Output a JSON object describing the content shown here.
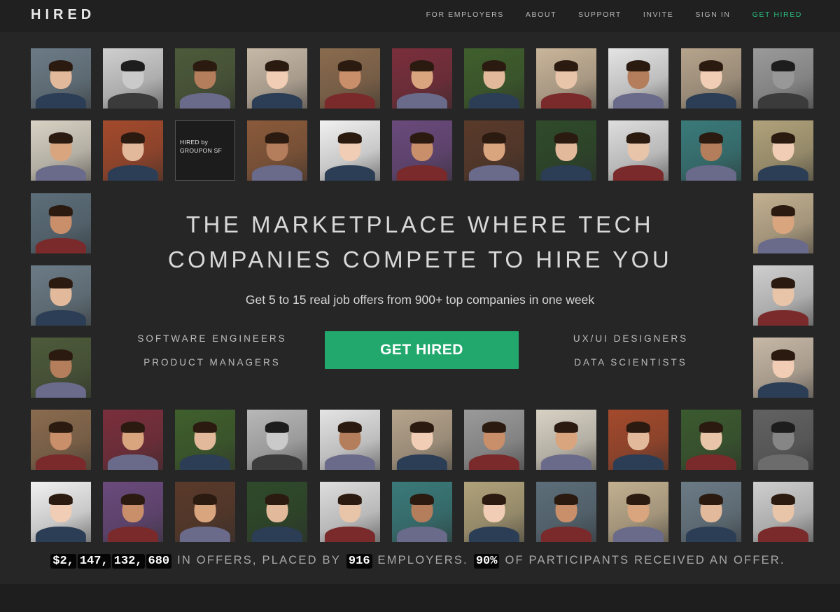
{
  "brand": {
    "logo": "HIRED"
  },
  "nav": {
    "items": [
      {
        "label": "FOR EMPLOYERS",
        "accent": false
      },
      {
        "label": "ABOUT",
        "accent": false
      },
      {
        "label": "SUPPORT",
        "accent": false
      },
      {
        "label": "INVITE",
        "accent": false
      },
      {
        "label": "SIGN IN",
        "accent": false
      },
      {
        "label": "GET HIRED",
        "accent": true
      }
    ]
  },
  "hero": {
    "title_line1": "THE MARKETPLACE WHERE TECH",
    "title_line2": "COMPANIES COMPETE TO HIRE YOU",
    "subtitle": "Get 5 to 15 real job offers from 900+ top companies in one week",
    "roles_left": [
      "SOFTWARE ENGINEERS",
      "PRODUCT MANAGERS"
    ],
    "roles_right": [
      "UX/UI DESIGNERS",
      "DATA SCIENTISTS"
    ],
    "cta_label": "GET HIRED"
  },
  "stats": {
    "offers_value": "$2,147,132,680",
    "text1": "IN OFFERS, PLACED BY",
    "employers_value": "916",
    "text2": "EMPLOYERS.",
    "percent_value": "90%",
    "text3": "OF PARTICIPANTS RECEIVED AN OFFER."
  },
  "photo_tiles": {
    "text_tile": "HIRED by GROUPON SF"
  },
  "colors": {
    "background": "#262626",
    "accent_green": "#22a86c",
    "nav_accent": "#2bbd7e"
  }
}
